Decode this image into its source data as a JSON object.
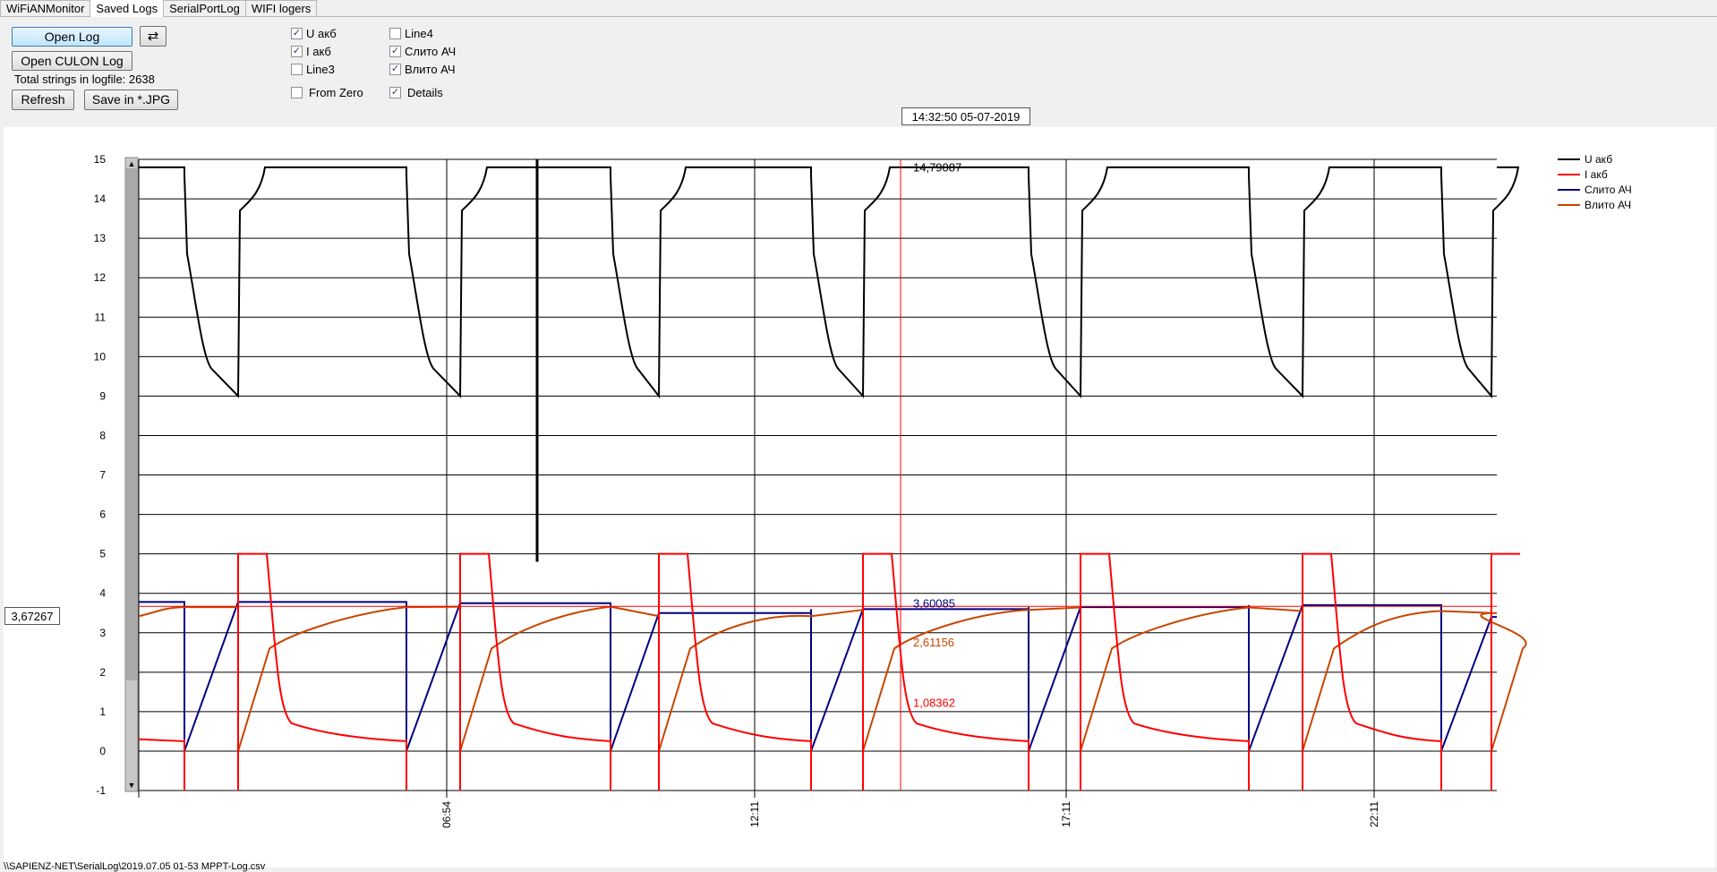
{
  "tabs": [
    "WiFiANMonitor",
    "Saved Logs",
    "SerialPortLog",
    "WIFI logers"
  ],
  "buttons": {
    "open_log": "Open Log",
    "open_culon_log": "Open CULON Log",
    "refresh": "Refresh",
    "save_jpg": "Save in *.JPG"
  },
  "total_strings": "Total strings in logfile: 2638",
  "checkboxes": {
    "u_akb": {
      "label": "U акб",
      "checked": true
    },
    "i_akb": {
      "label": "I акб",
      "checked": true
    },
    "line3": {
      "label": "Line3",
      "checked": false
    },
    "from_zero": {
      "label": "From Zero",
      "checked": false
    },
    "line4": {
      "label": "Line4",
      "checked": false
    },
    "slito": {
      "label": "Слито АЧ",
      "checked": true
    },
    "vlito": {
      "label": "Влито АЧ",
      "checked": true
    },
    "details": {
      "label": "Details",
      "checked": true
    }
  },
  "cursor_time": "14:32:50 05-07-2019",
  "cursor_value": "3,67267",
  "status_path": "\\\\SAPIENZ-NET\\SerialLog\\2019.07.05 01-53 MPPT-Log.csv",
  "chart_data": {
    "type": "line",
    "ylim": [
      -1,
      15
    ],
    "yticks": [
      "15",
      "14",
      "13",
      "12",
      "11",
      "10",
      "9",
      "8",
      "7",
      "6",
      "5",
      "4",
      "3",
      "2",
      "1",
      "0",
      "-1"
    ],
    "xticks": [
      "06:54",
      "12:11",
      "17:11",
      "22:11"
    ],
    "legend_position": "top-right",
    "grid": true,
    "series": [
      {
        "name": "U акб",
        "color": "#000000"
      },
      {
        "name": "I акб",
        "color": "#ff0000"
      },
      {
        "name": "Слито АЧ",
        "color": "#000080"
      },
      {
        "name": "Влито АЧ",
        "color": "#c84600"
      }
    ],
    "cursor_labels": [
      {
        "text": "14,79087",
        "color": "#000000"
      },
      {
        "text": "3,60085",
        "color": "#000080"
      },
      {
        "text": "2,61156",
        "color": "#c84600"
      },
      {
        "text": "1,08362",
        "color": "#ff0000"
      }
    ],
    "cursor_hline_value": 3.67,
    "cycles": [
      {
        "uStart": 14.8,
        "uEnd": 9.0,
        "slito": 3.78,
        "vlito": 3.65
      },
      {
        "uStart": 14.8,
        "uEnd": 9.0,
        "slito": 3.75,
        "vlito": 3.66
      },
      {
        "uStart": 14.8,
        "uEnd": 9.0,
        "slito": 3.5,
        "vlito": 3.42
      },
      {
        "uStart": 14.8,
        "uEnd": 9.0,
        "slito": 3.6,
        "vlito": 3.58
      },
      {
        "uStart": 14.8,
        "uEnd": 9.0,
        "slito": 3.65,
        "vlito": 3.64
      },
      {
        "uStart": 14.8,
        "uEnd": 9.0,
        "slito": 3.7,
        "vlito": 3.55
      },
      {
        "uStart": 14.8,
        "uEnd": 9.0,
        "slito": 3.4,
        "vlito": 3.5
      }
    ]
  }
}
